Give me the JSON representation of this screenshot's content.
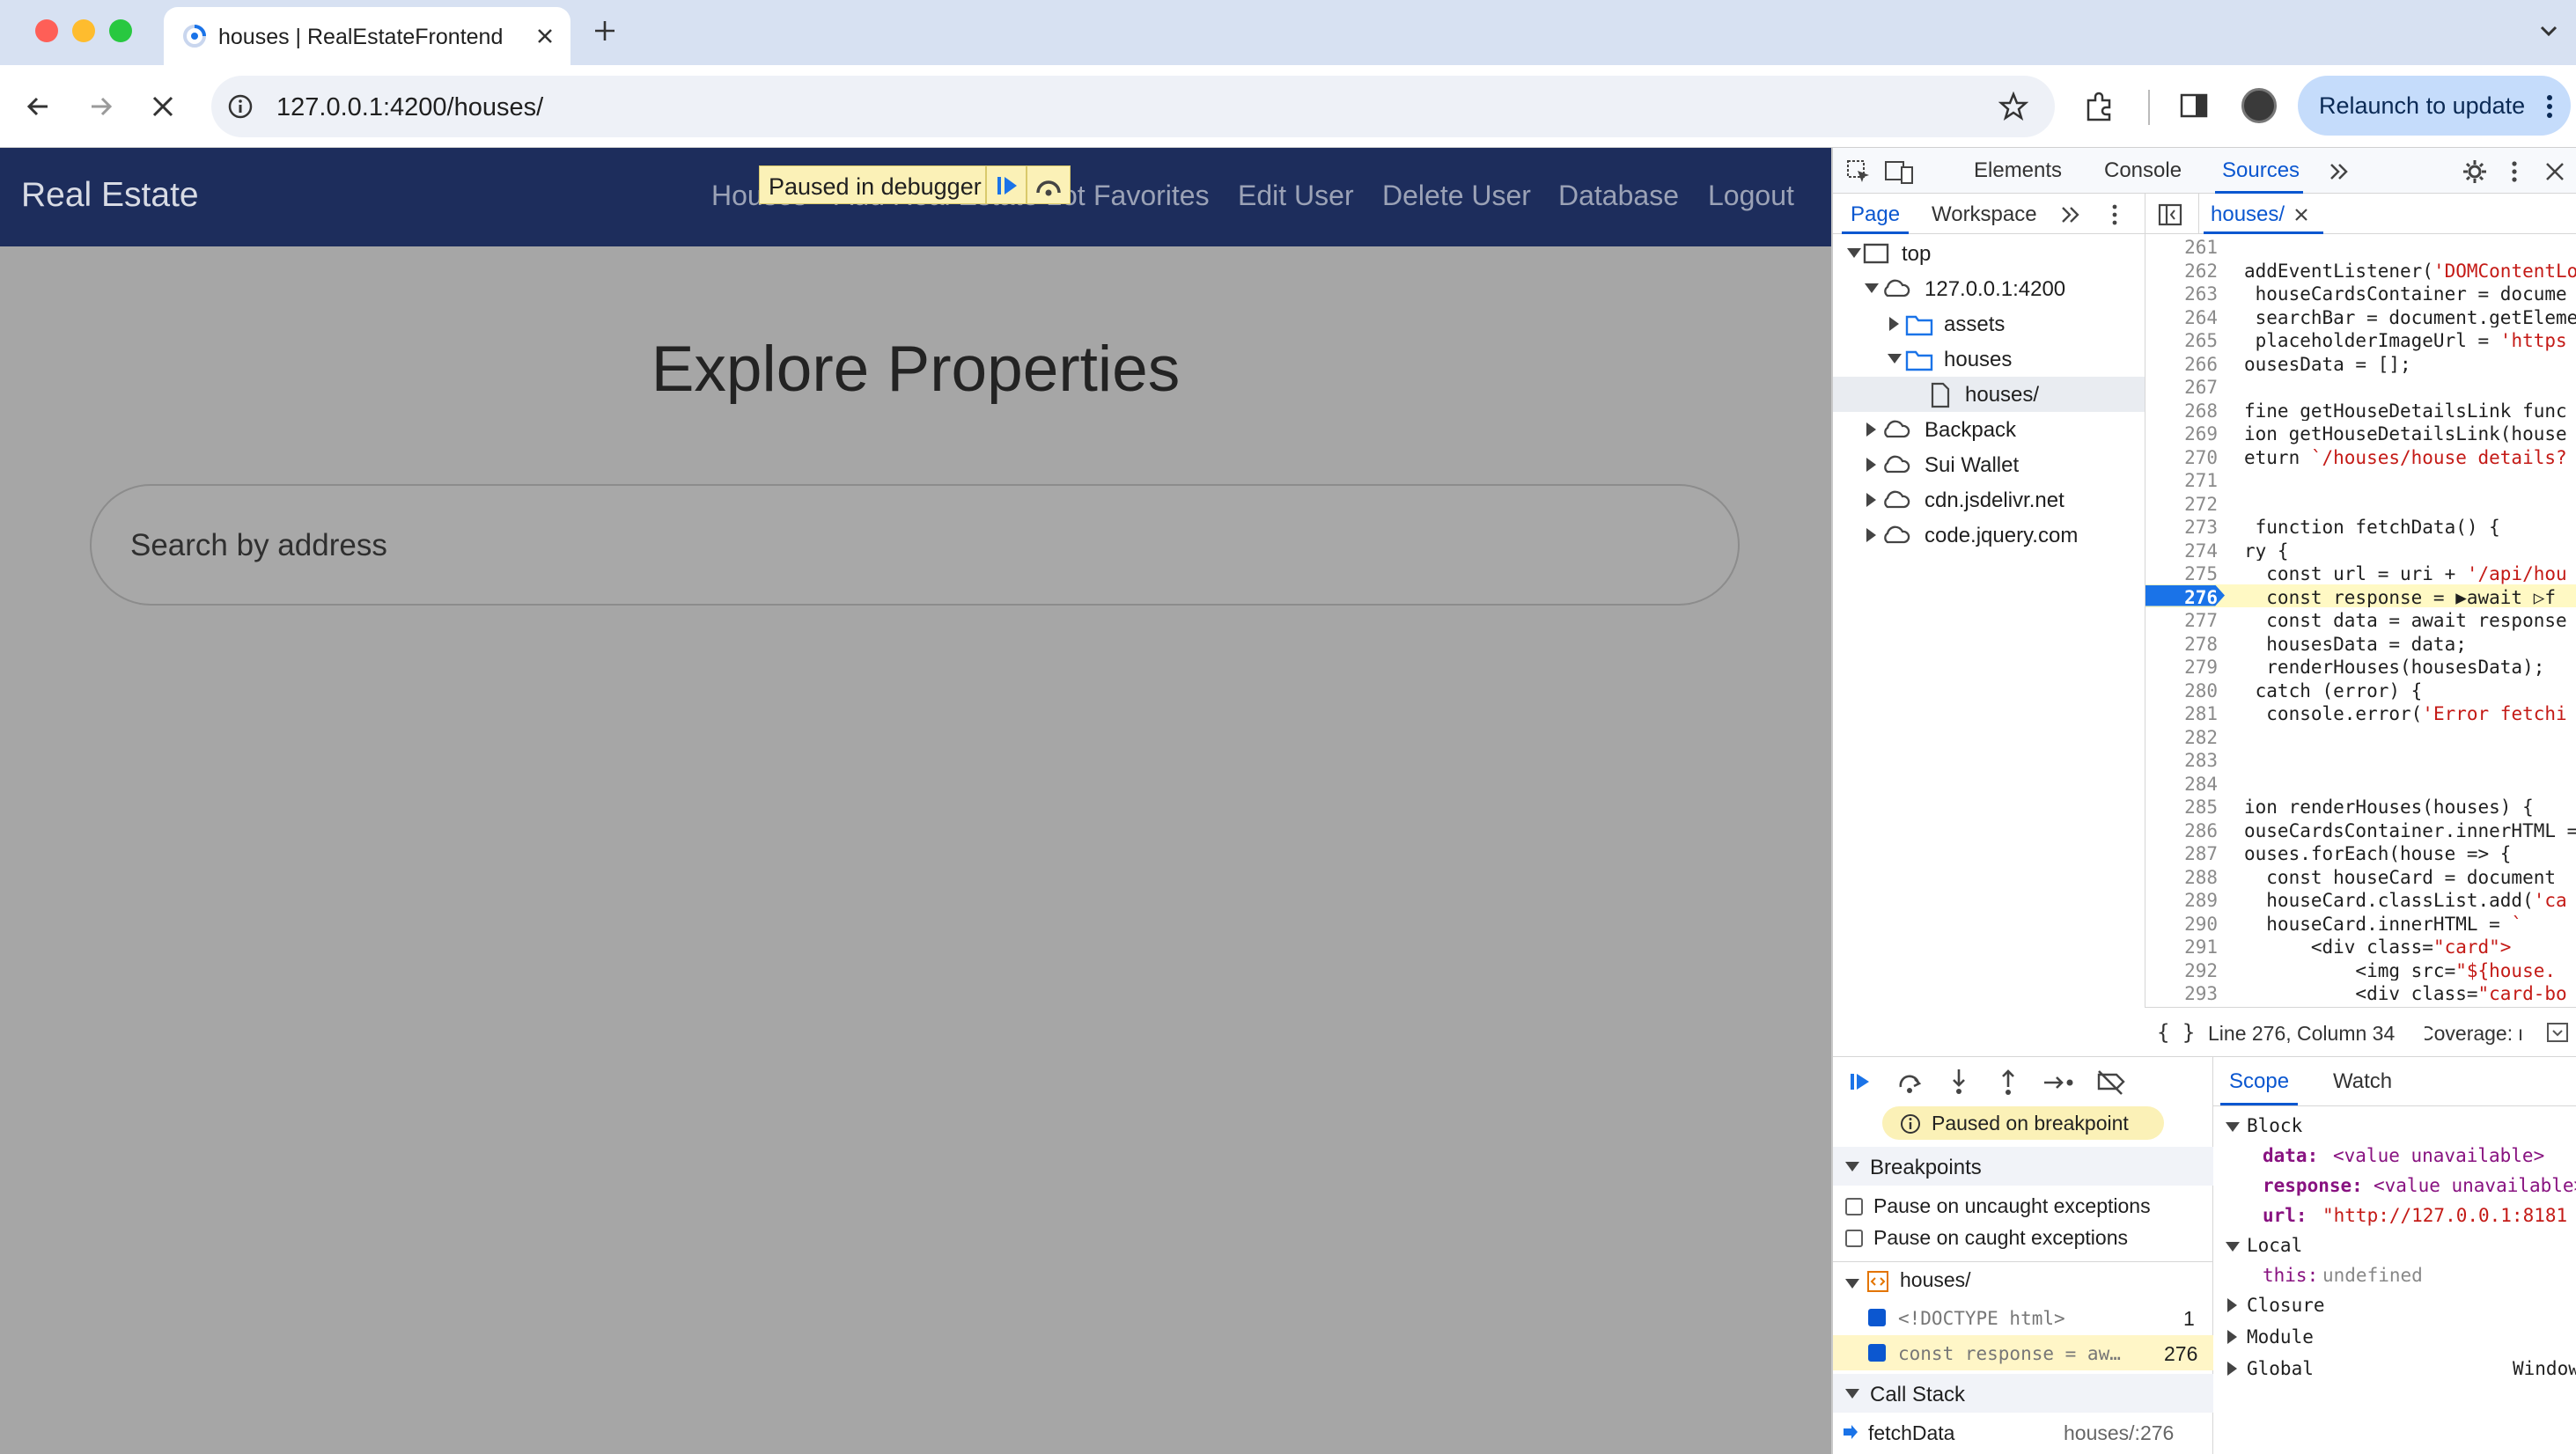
{
  "browser": {
    "tab_title": "houses | RealEstateFrontend",
    "url": "127.0.0.1:4200/houses/",
    "relaunch_label": "Relaunch to update"
  },
  "site": {
    "brand": "Real Estate",
    "nav": [
      "Houses",
      "Add Real Estate Lot",
      "Favorites",
      "Edit User",
      "Delete User",
      "Database",
      "Logout"
    ],
    "paused_banner": "Paused in debugger",
    "heading": "Explore Properties",
    "search_placeholder": "Search by address"
  },
  "devtools": {
    "tabs": [
      "Elements",
      "Console",
      "Sources"
    ],
    "active_tab": "Sources",
    "navigator_tabs": [
      "Page",
      "Workspace"
    ],
    "tree": [
      {
        "label": "top",
        "icon": "frame-icon",
        "depth": 0,
        "expanded": true
      },
      {
        "label": "127.0.0.1:4200",
        "icon": "cloud-icon",
        "depth": 1,
        "expanded": true
      },
      {
        "label": "assets",
        "icon": "folder-icon",
        "depth": 2,
        "expanded": false
      },
      {
        "label": "houses",
        "icon": "folder-icon",
        "depth": 2,
        "expanded": true
      },
      {
        "label": "houses/",
        "icon": "file-icon",
        "depth": 3,
        "selected": true
      },
      {
        "label": "Backpack",
        "icon": "cloud-icon",
        "depth": 1,
        "expanded": false
      },
      {
        "label": "Sui Wallet",
        "icon": "cloud-icon",
        "depth": 1,
        "expanded": false
      },
      {
        "label": "cdn.jsdelivr.net",
        "icon": "cloud-icon",
        "depth": 1,
        "expanded": false
      },
      {
        "label": "code.jquery.com",
        "icon": "cloud-icon",
        "depth": 1,
        "expanded": false
      }
    ],
    "editor_tab": "houses/",
    "code_lines": [
      {
        "n": "261",
        "t": ""
      },
      {
        "n": "262",
        "t": "addEventListener('DOMContentLo"
      },
      {
        "n": "263",
        "t": " houseCardsContainer = docume"
      },
      {
        "n": "264",
        "t": " searchBar = document.getEleme"
      },
      {
        "n": "265",
        "t": " placeholderImageUrl = 'https"
      },
      {
        "n": "266",
        "t": "ousesData = [];"
      },
      {
        "n": "267",
        "t": ""
      },
      {
        "n": "268",
        "t": "fine getHouseDetailsLink func"
      },
      {
        "n": "269",
        "t": "ion getHouseDetailsLink(house"
      },
      {
        "n": "270",
        "t": "eturn `/houses/house_details?"
      },
      {
        "n": "271",
        "t": ""
      },
      {
        "n": "272",
        "t": ""
      },
      {
        "n": "273",
        "t": " function fetchData() {"
      },
      {
        "n": "274",
        "t": "ry {"
      },
      {
        "n": "275",
        "t": "  const url = uri + '/api/hou"
      },
      {
        "n": "276",
        "t": "  const response = ▶await ▷f"
      },
      {
        "n": "277",
        "t": "  const data = await response"
      },
      {
        "n": "278",
        "t": "  housesData = data;"
      },
      {
        "n": "279",
        "t": "  renderHouses(housesData);"
      },
      {
        "n": "280",
        "t": " catch (error) {"
      },
      {
        "n": "281",
        "t": "  console.error('Error fetchi"
      },
      {
        "n": "282",
        "t": ""
      },
      {
        "n": "283",
        "t": ""
      },
      {
        "n": "284",
        "t": ""
      },
      {
        "n": "285",
        "t": "ion renderHouses(houses) {"
      },
      {
        "n": "286",
        "t": "ouseCardsContainer.innerHTML ="
      },
      {
        "n": "287",
        "t": "ouses.forEach(house => {"
      },
      {
        "n": "288",
        "t": "  const houseCard = document"
      },
      {
        "n": "289",
        "t": "  houseCard.classList.add('ca"
      },
      {
        "n": "290",
        "t": "  houseCard.innerHTML = `"
      },
      {
        "n": "291",
        "t": "      <div class=\"card\">"
      },
      {
        "n": "292",
        "t": "          <img src=\"${house."
      },
      {
        "n": "293",
        "t": "          <div class=\"card-bo"
      }
    ],
    "active_line": "276",
    "status": "Line 276, Column 34",
    "coverage": "Coverage: n/a",
    "paused_on_breakpoint": "Paused on breakpoint",
    "breakpoints_header": "Breakpoints",
    "pause_uncaught": "Pause on uncaught exceptions",
    "pause_caught": "Pause on caught exceptions",
    "bp_file": "houses/",
    "breakpoints": [
      {
        "code": "<!DOCTYPE html>",
        "line": "1"
      },
      {
        "code": "const response = aw…",
        "line": "276"
      }
    ],
    "call_stack_header": "Call Stack",
    "call_stack": [
      {
        "fn": "fetchData",
        "loc": "houses/:276"
      }
    ],
    "scope_tabs": [
      "Scope",
      "Watch"
    ],
    "scope": {
      "block_header": "Block",
      "block_vars": [
        {
          "name": "data:",
          "value": "<value unavailable>"
        },
        {
          "name": "response:",
          "value": "<value unavailable>"
        },
        {
          "name": "url:",
          "value": "\"http://127.0.0.1:8181"
        }
      ],
      "local_header": "Local",
      "local_vars": [
        {
          "name": "this:",
          "value": "undefined"
        }
      ],
      "closure": "Closure",
      "module": "Module",
      "global": "Global",
      "global_value": "Window"
    }
  },
  "colors": {
    "navbar": "#1d2d5c",
    "overlay_page": "#a6a6a6",
    "devtools_accent": "#0b57d0",
    "active_line_bg": "#fff9c4",
    "breakpoint_marker": "#1a73e8"
  }
}
